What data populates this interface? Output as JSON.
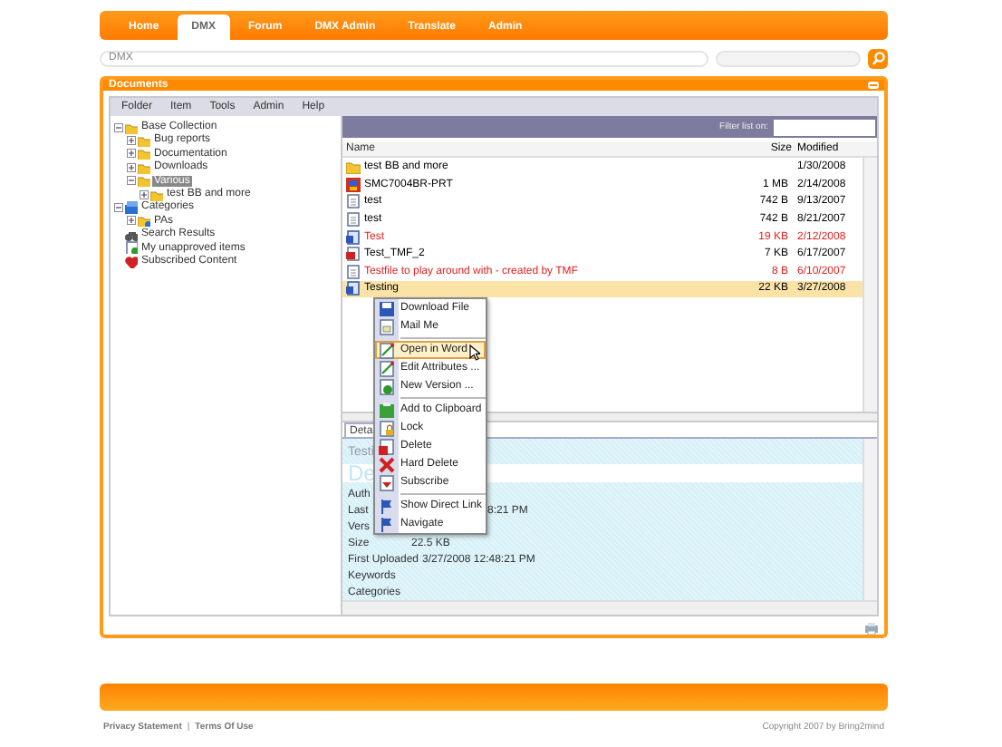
{
  "nav": {
    "tabs": [
      {
        "label": "Home",
        "selected": false
      },
      {
        "label": "DMX",
        "selected": true
      },
      {
        "label": "Forum",
        "selected": false
      },
      {
        "label": "DMX Admin",
        "selected": false
      },
      {
        "label": "Translate",
        "selected": false
      },
      {
        "label": "Admin",
        "selected": false
      }
    ]
  },
  "breadcrumb": "DMX",
  "panel": {
    "title": "Documents"
  },
  "menu_bar": [
    "Folder",
    "Item",
    "Tools",
    "Admin",
    "Help"
  ],
  "tree": [
    {
      "label": "Base Collection",
      "kind": "folder",
      "expanded": true,
      "selected": false,
      "children": [
        {
          "label": "Bug reports",
          "kind": "folder",
          "expanded": false,
          "selected": false
        },
        {
          "label": "Documentation",
          "kind": "folder",
          "expanded": false,
          "selected": false
        },
        {
          "label": "Downloads",
          "kind": "folder",
          "expanded": false,
          "selected": false
        },
        {
          "label": "Various",
          "kind": "folder",
          "expanded": true,
          "selected": true,
          "children": [
            {
              "label": "test BB and more",
              "kind": "folder",
              "expanded": false,
              "selected": false
            }
          ]
        }
      ]
    },
    {
      "label": "Categories",
      "kind": "categories",
      "expanded": true,
      "selected": false,
      "children": [
        {
          "label": "PAs",
          "kind": "category",
          "expanded": false,
          "selected": false
        }
      ]
    },
    {
      "label": "Search Results",
      "kind": "search",
      "selected": false
    },
    {
      "label": "My unapproved items",
      "kind": "unapproved",
      "selected": false
    },
    {
      "label": "Subscribed Content",
      "kind": "subscribed",
      "selected": false
    }
  ],
  "filter": {
    "label": "Filter list on:"
  },
  "list": {
    "columns": [
      "Name",
      "Size",
      "Modified"
    ],
    "rows": [
      {
        "name": "test BB and more",
        "kind": "folder",
        "size": "",
        "modified": "1/30/2008",
        "color": "#000000",
        "selected": false
      },
      {
        "name": "SMC7004BR-PRT",
        "kind": "program",
        "size": "1 MB",
        "modified": "2/14/2008",
        "color": "#000000",
        "selected": false
      },
      {
        "name": "test",
        "kind": "text",
        "size": "742 B",
        "modified": "9/13/2007",
        "color": "#000000",
        "selected": false
      },
      {
        "name": "test",
        "kind": "text",
        "size": "742 B",
        "modified": "8/21/2007",
        "color": "#000000",
        "selected": false
      },
      {
        "name": "Test",
        "kind": "word",
        "size": "19 KB",
        "modified": "2/12/2008",
        "color": "#e02020",
        "selected": false
      },
      {
        "name": "Test_TMF_2",
        "kind": "pdf",
        "size": "7 KB",
        "modified": "6/17/2007",
        "color": "#000000",
        "selected": false
      },
      {
        "name": "Testfile to play around with - created by TMF",
        "kind": "text",
        "size": "8 B",
        "modified": "6/10/2007",
        "color": "#e02020",
        "selected": false
      },
      {
        "name": "Testing",
        "kind": "word",
        "size": "22 KB",
        "modified": "3/27/2008",
        "color": "#000000",
        "selected": true
      }
    ]
  },
  "context_menu": [
    {
      "label": "Download File",
      "kind": "download",
      "selected": false
    },
    {
      "label": "Mail Me",
      "kind": "mail",
      "selected": false,
      "separator_after": true
    },
    {
      "label": "Open in Word",
      "kind": "edit",
      "selected": true
    },
    {
      "label": "Edit Attributes ...",
      "kind": "edit",
      "selected": false
    },
    {
      "label": "New Version ...",
      "kind": "new",
      "selected": false,
      "separator_after": true
    },
    {
      "label": "Add to Clipboard",
      "kind": "clipboard",
      "selected": false
    },
    {
      "label": "Lock",
      "kind": "lock",
      "selected": false
    },
    {
      "label": "Delete",
      "kind": "delete",
      "selected": false
    },
    {
      "label": "Hard Delete",
      "kind": "harddelete",
      "selected": false
    },
    {
      "label": "Subscribe",
      "kind": "subscribe",
      "selected": false,
      "separator_after": true
    },
    {
      "label": "Show Direct Link",
      "kind": "link",
      "selected": false
    },
    {
      "label": "Navigate",
      "kind": "link",
      "selected": false
    }
  ],
  "details": {
    "tab": "Deta",
    "title": "Testi",
    "heading": "De",
    "fields": [
      {
        "label": "Auth"
      },
      {
        "label": "Last",
        "value": "8:21 PM",
        "kind": "covered"
      },
      {
        "label": "Vers"
      },
      {
        "label": "Size",
        "value": "22.5 KB"
      },
      {
        "label": "First Uploaded",
        "value": "3/27/2008 12:48:21 PM"
      },
      {
        "label": "Keywords"
      },
      {
        "label": "Categories"
      }
    ]
  },
  "footer": {
    "links": [
      "Privacy Statement",
      "Terms Of Use"
    ],
    "separator": "|",
    "copyright": "Copyright 2007 by Bring2mind"
  }
}
